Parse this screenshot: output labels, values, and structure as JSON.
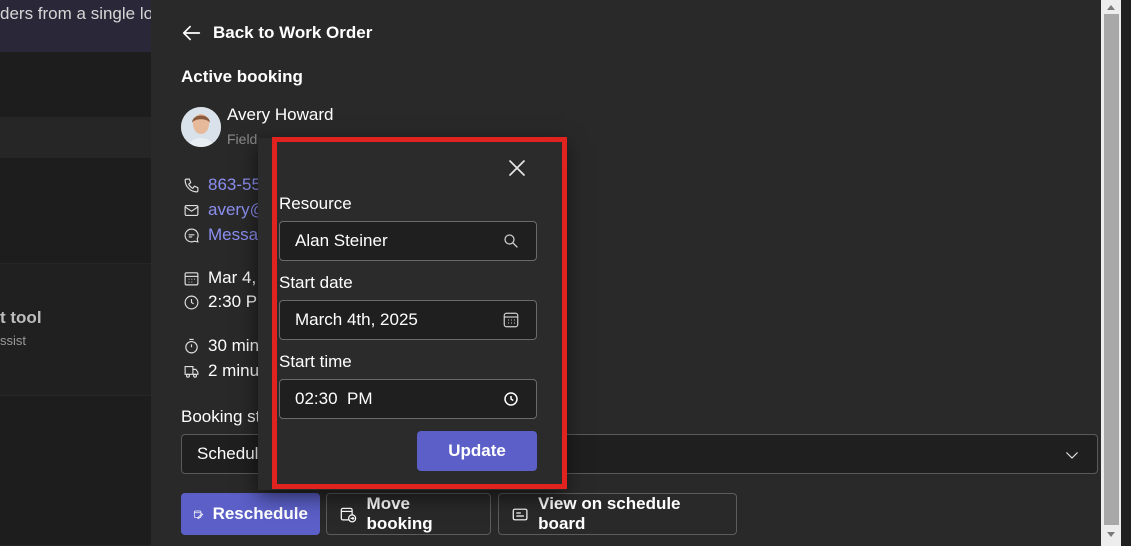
{
  "background": {
    "left_header_text": "ders from a single lo",
    "left_tool_title": "t tool",
    "left_tool_sub": "ssist"
  },
  "panel": {
    "back_label": "Back to Work Order",
    "section_title": "Active booking",
    "person": {
      "name": "Avery Howard",
      "role": "Field"
    },
    "phone": "863-55",
    "email": "avery@",
    "message": "Messa",
    "date": "Mar 4,",
    "time": "2:30 PI",
    "duration": "30 min",
    "travel": "2 minu",
    "booking_status_label": "Booking st",
    "booking_status_value": "Schedul"
  },
  "buttons": {
    "reschedule": "Reschedule",
    "move_booking": "Move booking",
    "view_schedule": "View on schedule board"
  },
  "popup": {
    "resource_label": "Resource",
    "resource_value": "Alan Steiner",
    "start_date_label": "Start date",
    "start_date_value": "March 4th, 2025",
    "start_time_label": "Start time",
    "start_time_value": "02:30  PM",
    "update_label": "Update"
  },
  "colors": {
    "accent": "#5b5fc7",
    "link": "#8b8ff0",
    "highlight": "#e0231e"
  }
}
